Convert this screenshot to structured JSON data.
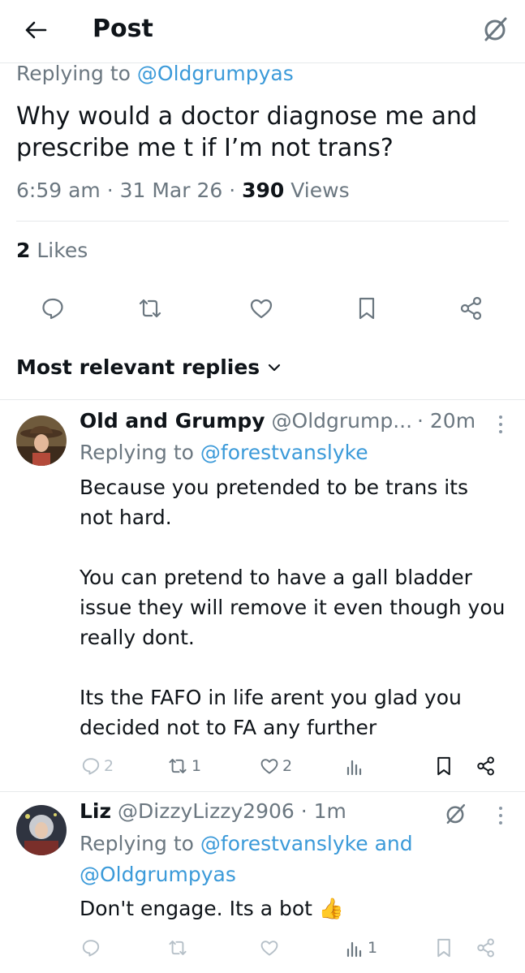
{
  "header": {
    "title": "Post",
    "back_icon": "back-arrow-icon",
    "grok_icon": "grok-icon"
  },
  "post": {
    "replying_label": "Replying to",
    "replying_handle": "@Oldgrumpyas",
    "text": "Why would a doctor diagnose me and\nprescribe me t if I’m not trans?",
    "time": "6:59 am · 31 Mar 26 · ",
    "views_count": "390",
    "views_label": " Views",
    "likes_count": "2",
    "likes_label": " Likes"
  },
  "sort": {
    "label": "Most relevant replies"
  },
  "replies": [
    {
      "name": "Old and Grumpy",
      "handle": "@Oldgrump...",
      "time": "· 20m",
      "replying_label": "Replying to",
      "replying_to": "@forestvanslyke",
      "body": "Because you pretended to be trans its\nnot hard.\n\nYou can pretend to have a gall bladder\nissue they will remove it even though you\nreally dont.\n\nIts the FAFO in life arent you glad you\ndecided not to FA any further",
      "reply_count": "2",
      "repost_count": "1",
      "like_count": "2",
      "views_count": ""
    },
    {
      "name": "Liz",
      "handle": "@DizzyLizzy2906",
      "time": "· 1m",
      "replying_label": "Replying to",
      "replying_to": "@forestvanslyke and",
      "replying_to_2": "@Oldgrumpyas",
      "body": "Don't engage. Its a bot",
      "emoji": "👍",
      "reply_count": "",
      "repost_count": "",
      "like_count": "",
      "views_count": "1"
    }
  ],
  "colors": {
    "text": "#0f1419",
    "secondary": "#6b7780",
    "link": "#3b9ad9",
    "divider": "#e6e9eb"
  }
}
